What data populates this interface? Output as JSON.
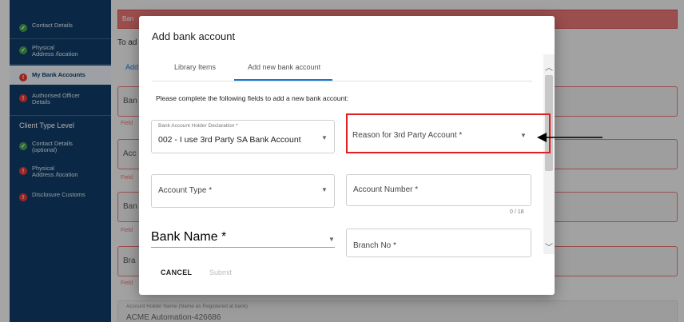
{
  "sidebar": {
    "items_top": [
      {
        "label": "Contact Details",
        "status": "ok"
      },
      {
        "label": "Physical\nAddress /location",
        "status": "ok"
      },
      {
        "label": "My Bank Accounts",
        "status": "error",
        "active": true
      },
      {
        "label": "Authorised Officer\nDetails",
        "status": "error"
      }
    ],
    "section_title": "Client Type Level",
    "items_bottom": [
      {
        "label": "Contact Details\n(optional)",
        "status": "ok"
      },
      {
        "label": "Physical\nAddress /location",
        "status": "error"
      },
      {
        "label": "Disclosure Customs",
        "status": "error"
      }
    ]
  },
  "background": {
    "banner_text": "Ban",
    "to_add_text": "To ad",
    "add_text": "Add",
    "fields": [
      {
        "prefix": "Ban",
        "label": "Field"
      },
      {
        "prefix": "Acc",
        "label": "Field"
      },
      {
        "prefix": "Ban",
        "label": "Field"
      },
      {
        "prefix": "Bra",
        "label": "Field"
      }
    ],
    "holder_name_label": "Account Holder Name (Name as Registered at bank)",
    "holder_name_value": "ACME Automation-426686"
  },
  "dialog": {
    "title": "Add bank account",
    "tabs": [
      {
        "label": "Library Items",
        "active": false
      },
      {
        "label": "Add new bank account",
        "active": true
      }
    ],
    "instruction": "Please complete the following fields to add a new bank account:",
    "declaration": {
      "label": "Bank Account Holder Declaration *",
      "value": "002 - I use 3rd Party SA Bank Account"
    },
    "reason": {
      "placeholder": "Reason for 3rd Party Account *"
    },
    "account_type": {
      "placeholder": "Account Type *"
    },
    "account_number": {
      "placeholder": "Account Number *",
      "counter": "0 / 18"
    },
    "bank_name": {
      "placeholder": "Bank Name *"
    },
    "branch_no": {
      "placeholder": "Branch No *"
    },
    "cancel_label": "CANCEL",
    "submit_label": "Submit"
  },
  "colors": {
    "sidebar_bg": "#0f3c66",
    "accent": "#1976d2",
    "error": "#e53935",
    "highlight": "#e02020"
  },
  "icons": {
    "ok_icon": "check-circle-icon",
    "error_icon": "error-circle-icon",
    "dropdown": "caret-down-icon",
    "scroll_up": "chevron-up-icon",
    "scroll_down": "chevron-down-icon",
    "annotation": "arrow-left-icon"
  }
}
